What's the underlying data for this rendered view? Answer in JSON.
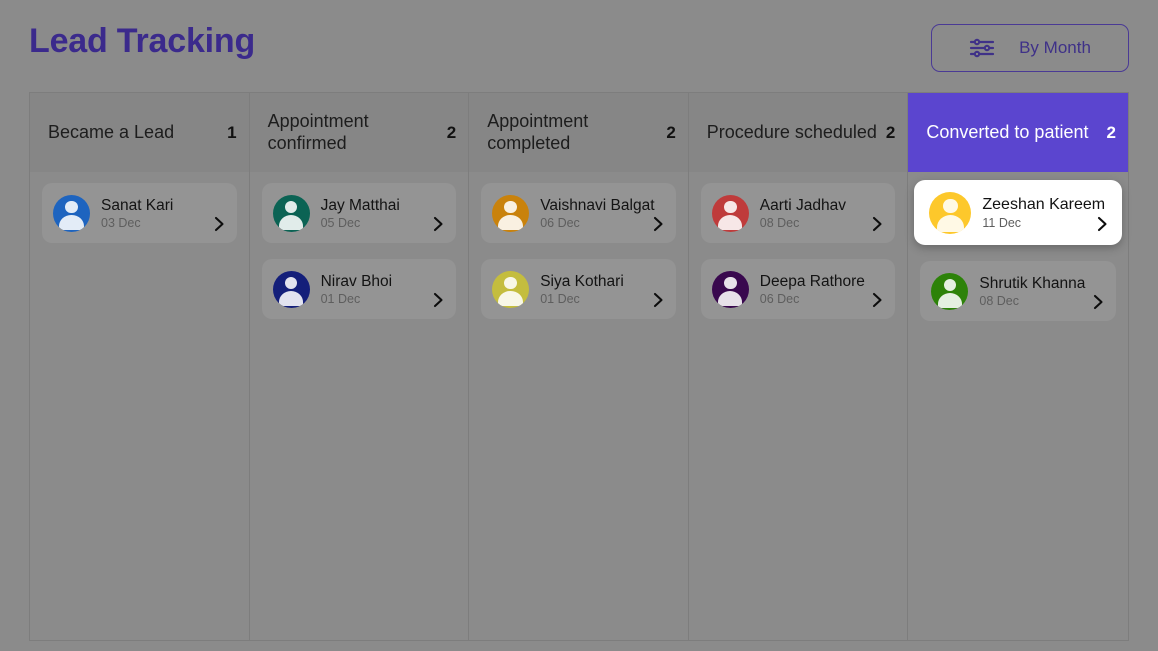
{
  "header": {
    "title": "Lead Tracking",
    "filter_button": {
      "label": "By Month",
      "icon": "sliders-icon"
    }
  },
  "theme": {
    "page_background": "#8b8b8b",
    "accent_purple": "#5b45cf",
    "title_color": "#3b2a8c",
    "card_background": "#949494",
    "card_highlight_background": "#ffffff",
    "column_header_background": "#868686",
    "border_color": "#7d7d7d"
  },
  "board": {
    "columns": [
      {
        "title": "Became a Lead",
        "count": "1",
        "active": false,
        "cards": [
          {
            "name": "Sanat Kari",
            "date": "03 Dec",
            "avatar_color": "#1e64bf",
            "highlight": false,
            "chevron": "chevron-right-icon"
          }
        ]
      },
      {
        "title": "Appointment confirmed",
        "count": "2",
        "active": false,
        "cards": [
          {
            "name": "Jay Matthai",
            "date": "05 Dec",
            "avatar_color": "#0b6354",
            "highlight": false,
            "chevron": "chevron-right-icon"
          },
          {
            "name": "Nirav Bhoi",
            "date": "01 Dec",
            "avatar_color": "#141f7a",
            "highlight": false,
            "chevron": "chevron-right-icon"
          }
        ]
      },
      {
        "title": "Appointment completed",
        "count": "2",
        "active": false,
        "cards": [
          {
            "name": "Vaishnavi Balgat",
            "date": "06 Dec",
            "avatar_color": "#c9820c",
            "highlight": false,
            "chevron": "chevron-right-icon"
          },
          {
            "name": "Siya Kothari",
            "date": "01 Dec",
            "avatar_color": "#c4bd3e",
            "highlight": false,
            "chevron": "chevron-right-icon"
          }
        ]
      },
      {
        "title": "Procedure scheduled",
        "count": "2",
        "active": false,
        "cards": [
          {
            "name": "Aarti Jadhav",
            "date": "08 Dec",
            "avatar_color": "#bf3b3b",
            "highlight": false,
            "chevron": "chevron-right-icon"
          },
          {
            "name": "Deepa Rathore",
            "date": "06 Dec",
            "avatar_color": "#39084e",
            "highlight": false,
            "chevron": "chevron-right-icon"
          }
        ]
      },
      {
        "title": "Converted to patient",
        "count": "2",
        "active": true,
        "cards": [
          {
            "name": "Zeeshan Kareem",
            "date": "11 Dec",
            "avatar_color": "#fdc82b",
            "highlight": true,
            "chevron": "chevron-right-icon"
          },
          {
            "name": "Shrutik Khanna",
            "date": "08 Dec",
            "avatar_color": "#2d8209",
            "highlight": false,
            "chevron": "chevron-right-icon"
          }
        ]
      }
    ]
  }
}
